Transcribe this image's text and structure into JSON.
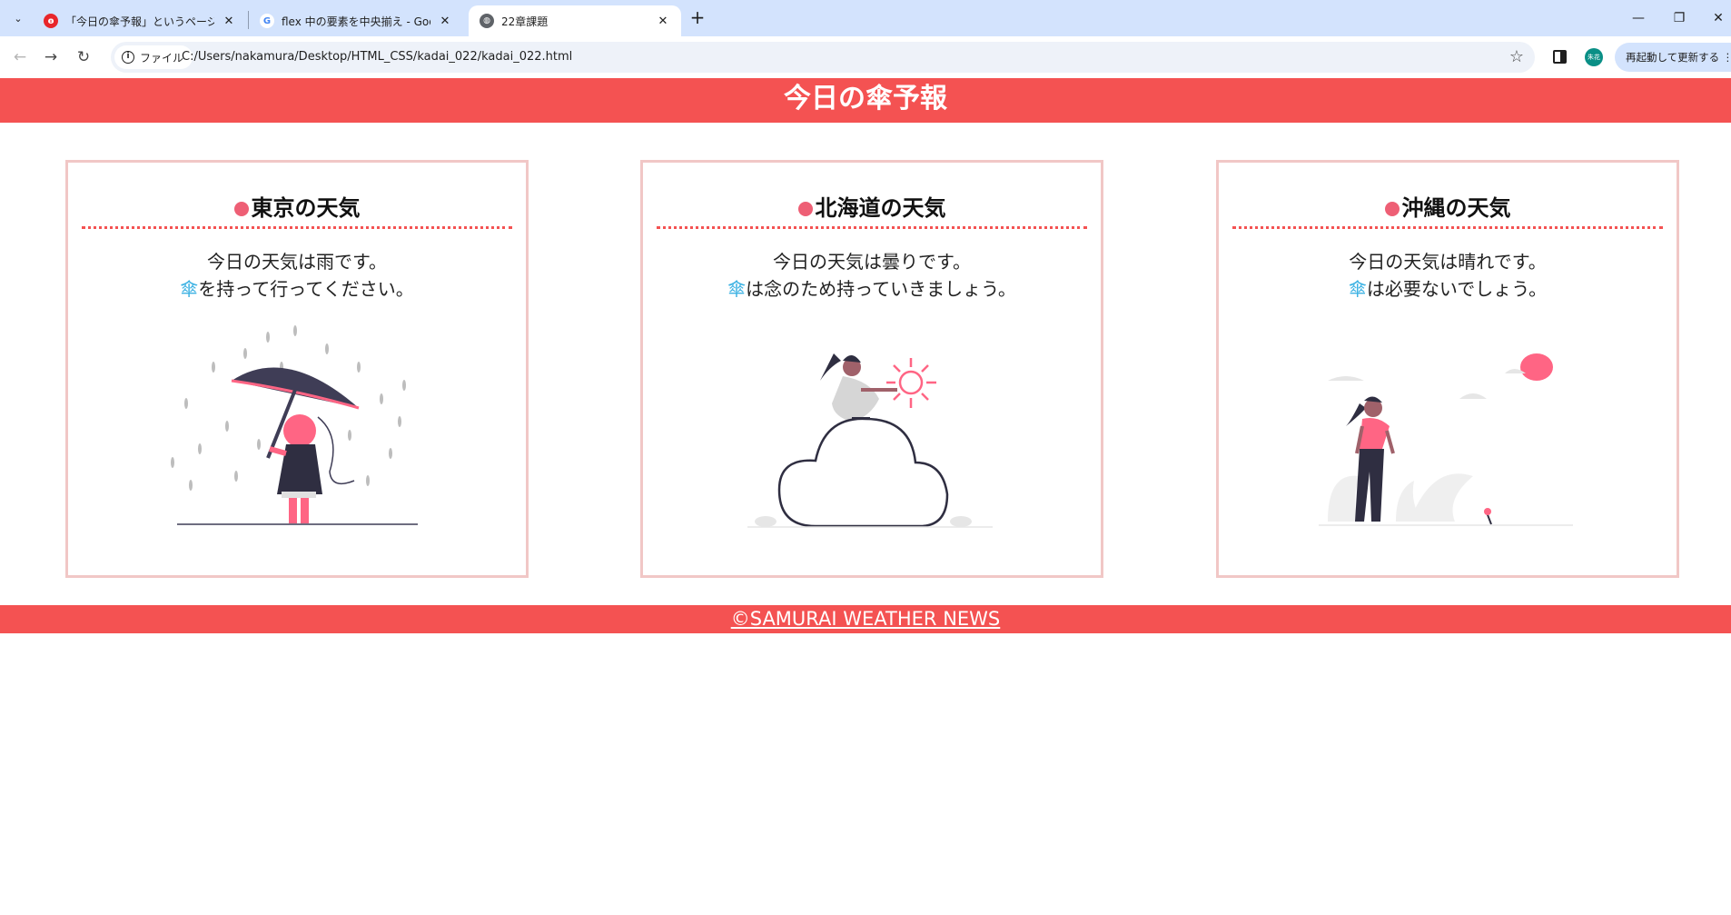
{
  "browser": {
    "tabs": [
      {
        "title": "「今日の傘予報」というページを作成",
        "active": false
      },
      {
        "title": "flex 中の要素を中央揃え - Google",
        "active": false
      },
      {
        "title": "22章課題",
        "active": true
      }
    ],
    "address": {
      "chip_label": "ファイル",
      "url": "C:/Users/nakamura/Desktop/HTML_CSS/kadai_022/kadai_022.html"
    },
    "profile_label": "朱花",
    "update_label": "再起動して更新する"
  },
  "page": {
    "title": "今日の傘予報",
    "cards": [
      {
        "heading": "東京の天気",
        "line1": "今日の天気は雨です。",
        "umbrella": "傘",
        "line2_rest": "を持って行ってください。",
        "illustration": "rain-umbrella"
      },
      {
        "heading": "北海道の天気",
        "line1": "今日の天気は曇りです。",
        "umbrella": "傘",
        "line2_rest": "は念のため持っていきましょう。",
        "illustration": "cloud-sun"
      },
      {
        "heading": "沖縄の天気",
        "line1": "今日の天気は晴れです。",
        "umbrella": "傘",
        "line2_rest": "は必要ないでしょう。",
        "illustration": "sunny-walk"
      }
    ],
    "footer": "©SAMURAI WEATHER NEWS"
  },
  "colors": {
    "brand": "#f45252",
    "card_border": "#f1c7c6",
    "dot": "#ee5f75",
    "umbrella_text": "#3db2e3"
  }
}
